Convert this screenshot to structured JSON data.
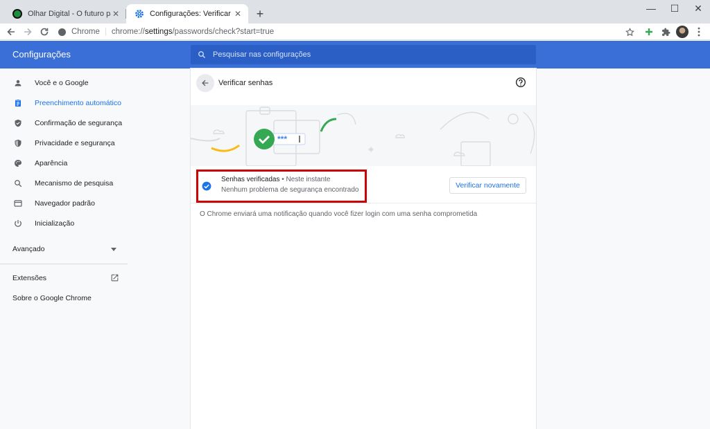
{
  "browser": {
    "tabs": [
      {
        "title": "Olhar Digital - O futuro passa pri",
        "active": false,
        "favicon": "globe-icon"
      },
      {
        "title": "Configurações: Verificar senhas",
        "active": true,
        "favicon": "gear-icon"
      }
    ],
    "new_tab_label": "+",
    "window_controls": {
      "minimize": "—",
      "maximize": "☐",
      "close": "✕"
    },
    "address": {
      "origin_label": "Chrome",
      "url_scheme": "chrome://",
      "url_host": "settings",
      "url_path": "/passwords/check?start=true"
    }
  },
  "settings": {
    "title": "Configurações",
    "search_placeholder": "Pesquisar nas configurações",
    "sidebar": {
      "items": [
        {
          "label": "Você e o Google",
          "icon": "person-icon",
          "active": false
        },
        {
          "label": "Preenchimento automático",
          "icon": "clipboard-icon",
          "active": true
        },
        {
          "label": "Confirmação de segurança",
          "icon": "shield-check-icon",
          "active": false
        },
        {
          "label": "Privacidade e segurança",
          "icon": "shield-icon",
          "active": false
        },
        {
          "label": "Aparência",
          "icon": "palette-icon",
          "active": false
        },
        {
          "label": "Mecanismo de pesquisa",
          "icon": "search-icon",
          "active": false
        },
        {
          "label": "Navegador padrão",
          "icon": "browser-icon",
          "active": false
        },
        {
          "label": "Inicialização",
          "icon": "power-icon",
          "active": false
        }
      ],
      "advanced_label": "Avançado",
      "extensions_label": "Extensões",
      "about_label": "Sobre o Google Chrome"
    },
    "page": {
      "title": "Verificar senhas",
      "status_title": "Senhas verificadas",
      "status_time": " • Neste instante",
      "status_detail": "Nenhum problema de segurança encontrado",
      "recheck_label": "Verificar novamente",
      "notice": "O Chrome enviará uma notificação quando você fizer login com uma senha comprometida",
      "illustration_password": "***"
    }
  },
  "colors": {
    "header_blue": "#3b6fd8",
    "accent": "#1a73e8",
    "success_green": "#34a853",
    "highlight_red": "#cc0000"
  }
}
